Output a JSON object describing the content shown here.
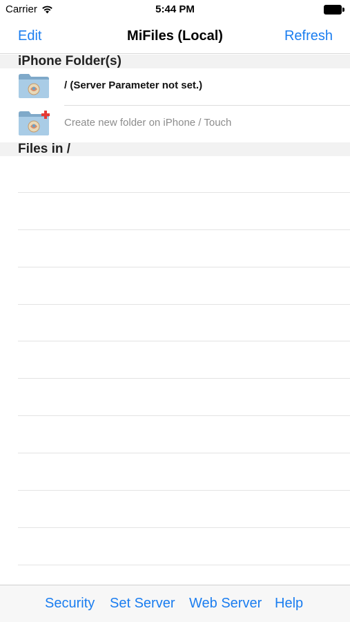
{
  "status": {
    "carrier": "Carrier",
    "time": "5:44 PM"
  },
  "nav": {
    "edit_label": "Edit",
    "title": "MiFiles (Local)",
    "refresh_label": "Refresh"
  },
  "folders_section": {
    "header": "iPhone Folder(s)",
    "items": [
      {
        "label": "/ (Server Parameter not set.)"
      },
      {
        "label": "Create new folder on iPhone / Touch"
      }
    ]
  },
  "files_section": {
    "header": "Files in /"
  },
  "toolbar": {
    "security_label": "Security",
    "set_server_label": "Set Server",
    "web_server_label": "Web Server",
    "help_label": "Help"
  },
  "colors": {
    "accent": "#1a7df0",
    "folder": "#8fb8d6",
    "add_badge": "#e53935"
  },
  "icons": [
    "wifi-icon",
    "battery-icon",
    "folder-icon",
    "folder-add-icon"
  ]
}
